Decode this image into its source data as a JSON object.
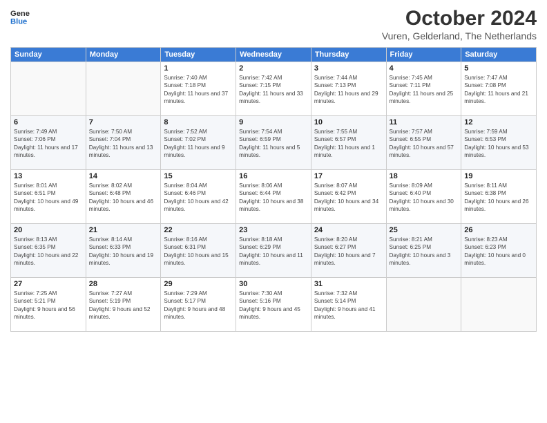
{
  "header": {
    "logo_general": "General",
    "logo_blue": "Blue",
    "main_title": "October 2024",
    "subtitle": "Vuren, Gelderland, The Netherlands"
  },
  "days_of_week": [
    "Sunday",
    "Monday",
    "Tuesday",
    "Wednesday",
    "Thursday",
    "Friday",
    "Saturday"
  ],
  "weeks": [
    {
      "days": [
        {
          "date": "",
          "info": ""
        },
        {
          "date": "",
          "info": ""
        },
        {
          "date": "1",
          "info": "Sunrise: 7:40 AM\nSunset: 7:18 PM\nDaylight: 11 hours and 37 minutes."
        },
        {
          "date": "2",
          "info": "Sunrise: 7:42 AM\nSunset: 7:15 PM\nDaylight: 11 hours and 33 minutes."
        },
        {
          "date": "3",
          "info": "Sunrise: 7:44 AM\nSunset: 7:13 PM\nDaylight: 11 hours and 29 minutes."
        },
        {
          "date": "4",
          "info": "Sunrise: 7:45 AM\nSunset: 7:11 PM\nDaylight: 11 hours and 25 minutes."
        },
        {
          "date": "5",
          "info": "Sunrise: 7:47 AM\nSunset: 7:08 PM\nDaylight: 11 hours and 21 minutes."
        }
      ]
    },
    {
      "days": [
        {
          "date": "6",
          "info": "Sunrise: 7:49 AM\nSunset: 7:06 PM\nDaylight: 11 hours and 17 minutes."
        },
        {
          "date": "7",
          "info": "Sunrise: 7:50 AM\nSunset: 7:04 PM\nDaylight: 11 hours and 13 minutes."
        },
        {
          "date": "8",
          "info": "Sunrise: 7:52 AM\nSunset: 7:02 PM\nDaylight: 11 hours and 9 minutes."
        },
        {
          "date": "9",
          "info": "Sunrise: 7:54 AM\nSunset: 6:59 PM\nDaylight: 11 hours and 5 minutes."
        },
        {
          "date": "10",
          "info": "Sunrise: 7:55 AM\nSunset: 6:57 PM\nDaylight: 11 hours and 1 minute."
        },
        {
          "date": "11",
          "info": "Sunrise: 7:57 AM\nSunset: 6:55 PM\nDaylight: 10 hours and 57 minutes."
        },
        {
          "date": "12",
          "info": "Sunrise: 7:59 AM\nSunset: 6:53 PM\nDaylight: 10 hours and 53 minutes."
        }
      ]
    },
    {
      "days": [
        {
          "date": "13",
          "info": "Sunrise: 8:01 AM\nSunset: 6:51 PM\nDaylight: 10 hours and 49 minutes."
        },
        {
          "date": "14",
          "info": "Sunrise: 8:02 AM\nSunset: 6:48 PM\nDaylight: 10 hours and 46 minutes."
        },
        {
          "date": "15",
          "info": "Sunrise: 8:04 AM\nSunset: 6:46 PM\nDaylight: 10 hours and 42 minutes."
        },
        {
          "date": "16",
          "info": "Sunrise: 8:06 AM\nSunset: 6:44 PM\nDaylight: 10 hours and 38 minutes."
        },
        {
          "date": "17",
          "info": "Sunrise: 8:07 AM\nSunset: 6:42 PM\nDaylight: 10 hours and 34 minutes."
        },
        {
          "date": "18",
          "info": "Sunrise: 8:09 AM\nSunset: 6:40 PM\nDaylight: 10 hours and 30 minutes."
        },
        {
          "date": "19",
          "info": "Sunrise: 8:11 AM\nSunset: 6:38 PM\nDaylight: 10 hours and 26 minutes."
        }
      ]
    },
    {
      "days": [
        {
          "date": "20",
          "info": "Sunrise: 8:13 AM\nSunset: 6:35 PM\nDaylight: 10 hours and 22 minutes."
        },
        {
          "date": "21",
          "info": "Sunrise: 8:14 AM\nSunset: 6:33 PM\nDaylight: 10 hours and 19 minutes."
        },
        {
          "date": "22",
          "info": "Sunrise: 8:16 AM\nSunset: 6:31 PM\nDaylight: 10 hours and 15 minutes."
        },
        {
          "date": "23",
          "info": "Sunrise: 8:18 AM\nSunset: 6:29 PM\nDaylight: 10 hours and 11 minutes."
        },
        {
          "date": "24",
          "info": "Sunrise: 8:20 AM\nSunset: 6:27 PM\nDaylight: 10 hours and 7 minutes."
        },
        {
          "date": "25",
          "info": "Sunrise: 8:21 AM\nSunset: 6:25 PM\nDaylight: 10 hours and 3 minutes."
        },
        {
          "date": "26",
          "info": "Sunrise: 8:23 AM\nSunset: 6:23 PM\nDaylight: 10 hours and 0 minutes."
        }
      ]
    },
    {
      "days": [
        {
          "date": "27",
          "info": "Sunrise: 7:25 AM\nSunset: 5:21 PM\nDaylight: 9 hours and 56 minutes."
        },
        {
          "date": "28",
          "info": "Sunrise: 7:27 AM\nSunset: 5:19 PM\nDaylight: 9 hours and 52 minutes."
        },
        {
          "date": "29",
          "info": "Sunrise: 7:29 AM\nSunset: 5:17 PM\nDaylight: 9 hours and 48 minutes."
        },
        {
          "date": "30",
          "info": "Sunrise: 7:30 AM\nSunset: 5:16 PM\nDaylight: 9 hours and 45 minutes."
        },
        {
          "date": "31",
          "info": "Sunrise: 7:32 AM\nSunset: 5:14 PM\nDaylight: 9 hours and 41 minutes."
        },
        {
          "date": "",
          "info": ""
        },
        {
          "date": "",
          "info": ""
        }
      ]
    }
  ]
}
